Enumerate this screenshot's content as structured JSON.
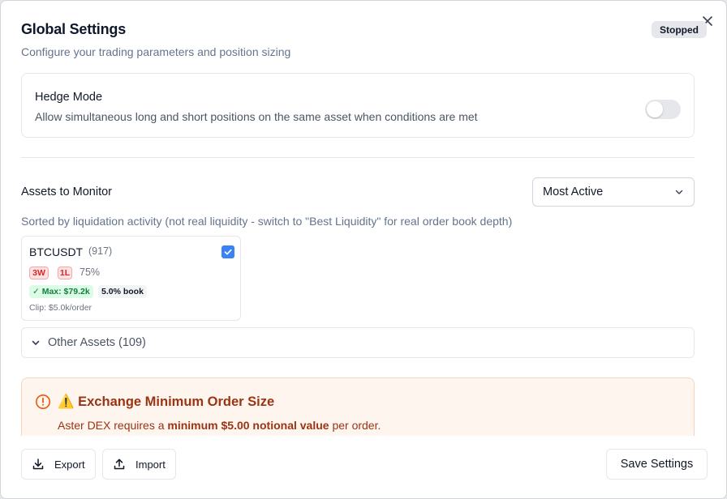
{
  "dialog": {
    "title": "Global Settings",
    "subtitle": "Configure your trading parameters and position sizing",
    "status_badge": "Stopped"
  },
  "hedge_mode": {
    "title": "Hedge Mode",
    "description": "Allow simultaneous long and short positions on the same asset when conditions are met",
    "enabled": false
  },
  "assets": {
    "label": "Assets to Monitor",
    "sort_selected": "Most Active",
    "sort_note": "Sorted by liquidation activity (not real liquidity - switch to \"Best Liquidity\" for real order book depth)",
    "items": [
      {
        "symbol": "BTCUSDT",
        "count": "(917)",
        "tag_a": "3W",
        "tag_b": "1L",
        "percent": "75%",
        "max_label": "✓ Max: $79.2k",
        "book_label": "5.0% book",
        "clip_label": "Clip: $5.0k/order",
        "checked": true
      }
    ],
    "other_label": "Other Assets (109)"
  },
  "warning": {
    "title": "⚠️ Exchange Minimum Order Size",
    "text_before": "Aster DEX requires a ",
    "text_bold": "minimum $5.00 notional value",
    "text_after": " per order."
  },
  "footer": {
    "export_label": "Export",
    "import_label": "Import",
    "save_label": "Save Settings"
  },
  "colors": {
    "accent": "#3b82f6",
    "warning_bg": "#fef5ee",
    "warning_text": "#9a3412",
    "danger": "#dc2626",
    "success": "#15803d"
  }
}
